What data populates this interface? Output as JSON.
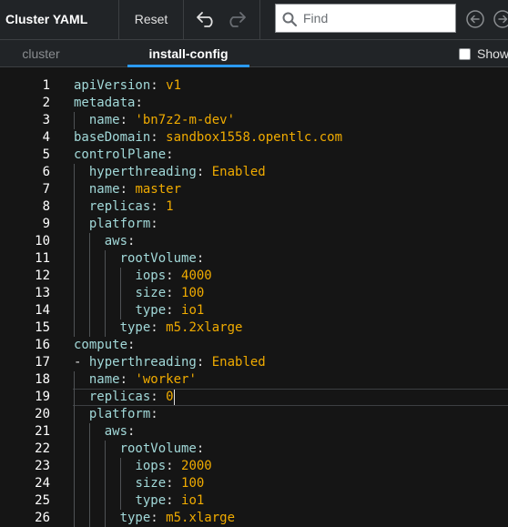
{
  "toolbar": {
    "title": "Cluster YAML",
    "reset_label": "Reset",
    "find_placeholder": "Find"
  },
  "tabs": {
    "items": [
      {
        "label": "cluster"
      },
      {
        "label": "install-config",
        "active": true
      }
    ],
    "show_checkbox_label": "Show"
  },
  "colors": {
    "key": "#a2d9d9",
    "value": "#f0ab00",
    "accent": "#2b9af3"
  },
  "editor": {
    "active_line": 19,
    "lines": [
      {
        "n": "1",
        "indent": "",
        "dash": "",
        "key": "apiVersion",
        "value": "v1"
      },
      {
        "n": "2",
        "indent": "",
        "dash": "",
        "key": "metadata",
        "value": ""
      },
      {
        "n": "3",
        "indent": "  ",
        "dash": "",
        "key": "name",
        "value": "'bn7z2-m-dev'"
      },
      {
        "n": "4",
        "indent": "",
        "dash": "",
        "key": "baseDomain",
        "value": "sandbox1558.opentlc.com"
      },
      {
        "n": "5",
        "indent": "",
        "dash": "",
        "key": "controlPlane",
        "value": ""
      },
      {
        "n": "6",
        "indent": "  ",
        "dash": "",
        "key": "hyperthreading",
        "value": "Enabled"
      },
      {
        "n": "7",
        "indent": "  ",
        "dash": "",
        "key": "name",
        "value": "master"
      },
      {
        "n": "8",
        "indent": "  ",
        "dash": "",
        "key": "replicas",
        "value": "1"
      },
      {
        "n": "9",
        "indent": "  ",
        "dash": "",
        "key": "platform",
        "value": ""
      },
      {
        "n": "10",
        "indent": "    ",
        "dash": "",
        "key": "aws",
        "value": ""
      },
      {
        "n": "11",
        "indent": "      ",
        "dash": "",
        "key": "rootVolume",
        "value": ""
      },
      {
        "n": "12",
        "indent": "        ",
        "dash": "",
        "key": "iops",
        "value": "4000"
      },
      {
        "n": "13",
        "indent": "        ",
        "dash": "",
        "key": "size",
        "value": "100"
      },
      {
        "n": "14",
        "indent": "        ",
        "dash": "",
        "key": "type",
        "value": "io1"
      },
      {
        "n": "15",
        "indent": "      ",
        "dash": "",
        "key": "type",
        "value": "m5.2xlarge"
      },
      {
        "n": "16",
        "indent": "",
        "dash": "",
        "key": "compute",
        "value": ""
      },
      {
        "n": "17",
        "indent": "",
        "dash": "- ",
        "key": "hyperthreading",
        "value": "Enabled"
      },
      {
        "n": "18",
        "indent": "  ",
        "dash": "",
        "key": "name",
        "value": "'worker'"
      },
      {
        "n": "19",
        "indent": "  ",
        "dash": "",
        "key": "replicas",
        "value": "0"
      },
      {
        "n": "20",
        "indent": "  ",
        "dash": "",
        "key": "platform",
        "value": ""
      },
      {
        "n": "21",
        "indent": "    ",
        "dash": "",
        "key": "aws",
        "value": ""
      },
      {
        "n": "22",
        "indent": "      ",
        "dash": "",
        "key": "rootVolume",
        "value": ""
      },
      {
        "n": "23",
        "indent": "        ",
        "dash": "",
        "key": "iops",
        "value": "2000"
      },
      {
        "n": "24",
        "indent": "        ",
        "dash": "",
        "key": "size",
        "value": "100"
      },
      {
        "n": "25",
        "indent": "        ",
        "dash": "",
        "key": "type",
        "value": "io1"
      },
      {
        "n": "26",
        "indent": "      ",
        "dash": "",
        "key": "type",
        "value": "m5.xlarge"
      }
    ]
  }
}
